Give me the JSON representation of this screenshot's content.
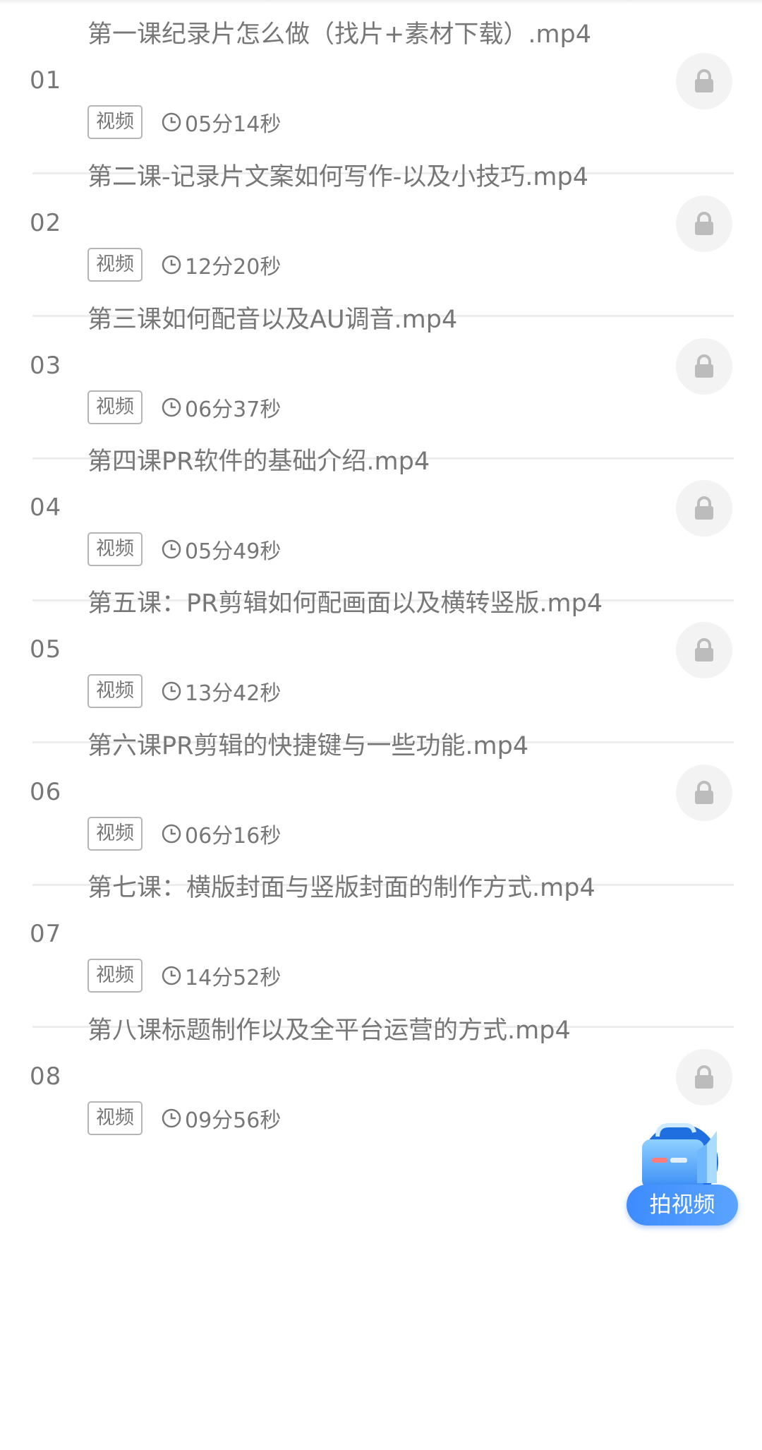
{
  "lessons": [
    {
      "num": "01",
      "title": "第一课纪录片怎么做（找片+素材下载）.mp4",
      "tag": "视频",
      "duration": "05分14秒"
    },
    {
      "num": "02",
      "title": "第二课-记录片文案如何写作-以及小技巧.mp4",
      "tag": "视频",
      "duration": "12分20秒"
    },
    {
      "num": "03",
      "title": "第三课如何配音以及AU调音.mp4",
      "tag": "视频",
      "duration": "06分37秒"
    },
    {
      "num": "04",
      "title": "第四课PR软件的基础介绍.mp4",
      "tag": "视频",
      "duration": "05分49秒"
    },
    {
      "num": "05",
      "title": "第五课：PR剪辑如何配画面以及横转竖版.mp4",
      "tag": "视频",
      "duration": "13分42秒"
    },
    {
      "num": "06",
      "title": "第六课PR剪辑的快捷键与一些功能.mp4",
      "tag": "视频",
      "duration": "06分16秒"
    },
    {
      "num": "07",
      "title": "第七课：横版封面与竖版封面的制作方式.mp4",
      "tag": "视频",
      "duration": "14分52秒"
    },
    {
      "num": "08",
      "title": "第八课标题制作以及全平台运营的方式.mp4",
      "tag": "视频",
      "duration": "09分56秒"
    }
  ],
  "fab": {
    "label": "拍视频",
    "icon": "camera-bag-icon"
  },
  "icons": {
    "clock": "clock-icon",
    "lock": "lock-icon"
  },
  "colors": {
    "text": "#777777",
    "divider": "#ededed",
    "lock_bg": "#f3f3f3",
    "fab": "#3d8bff"
  }
}
